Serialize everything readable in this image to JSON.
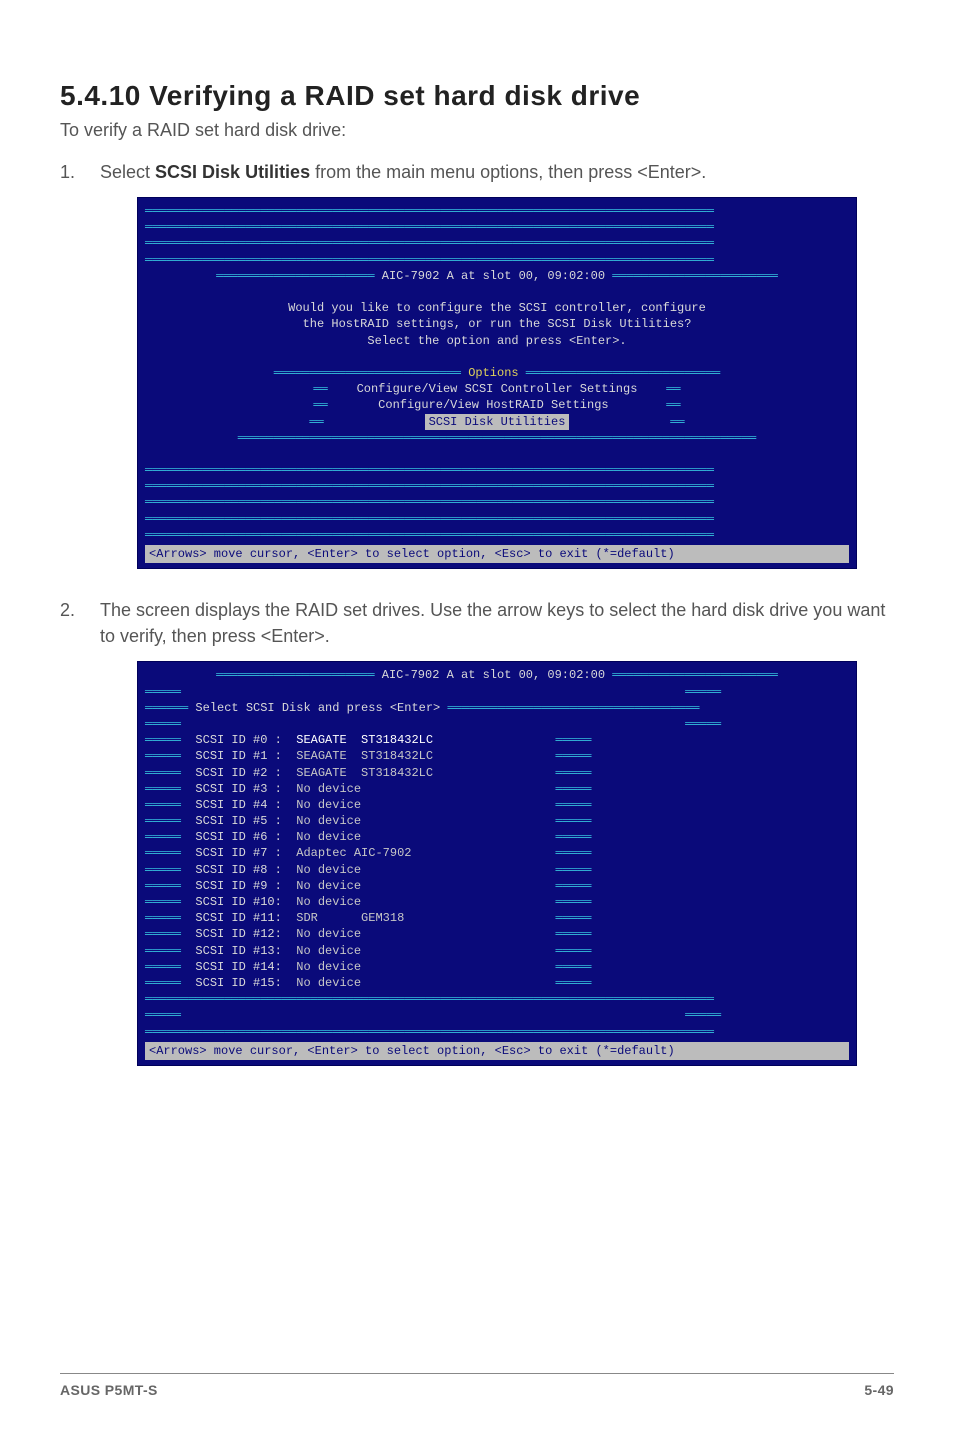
{
  "section_heading": "5.4.10 Verifying a RAID set hard disk drive",
  "intro_text": "To verify a RAID set hard disk drive:",
  "steps": [
    {
      "pre_bold": "Select ",
      "bold": "SCSI Disk Utilities",
      "post_bold": " from the main menu options, then press <Enter>."
    },
    {
      "text": "The screen displays the RAID set drives. Use the arrow keys to select the hard disk drive you want to verify, then press <Enter>."
    }
  ],
  "bios1": {
    "title_line": "AIC-7902 A at slot 00, 09:02:00",
    "prompt_lines": [
      "Would you like to configure the SCSI controller, configure",
      "the HostRAID settings, or run the SCSI Disk Utilities?",
      "Select the option and press <Enter>."
    ],
    "options_header": "Options",
    "options": [
      "Configure/View SCSI Controller Settings",
      "Configure/View HostRAID Settings",
      "SCSI Disk Utilities"
    ],
    "selected_index": 2,
    "footer": "<Arrows> move cursor, <Enter> to select option, <Esc> to exit (*=default)"
  },
  "bios2": {
    "title_line": "AIC-7902 A at slot 00, 09:02:00",
    "subtitle": "Select SCSI Disk and press <Enter>",
    "devices": [
      {
        "id": "SCSI ID #0 :",
        "desc": "SEAGATE  ST318432LC"
      },
      {
        "id": "SCSI ID #1 :",
        "desc": "SEAGATE  ST318432LC"
      },
      {
        "id": "SCSI ID #2 :",
        "desc": "SEAGATE  ST318432LC"
      },
      {
        "id": "SCSI ID #3 :",
        "desc": "No device"
      },
      {
        "id": "SCSI ID #4 :",
        "desc": "No device"
      },
      {
        "id": "SCSI ID #5 :",
        "desc": "No device"
      },
      {
        "id": "SCSI ID #6 :",
        "desc": "No device"
      },
      {
        "id": "SCSI ID #7 :",
        "desc": "Adaptec AIC-7902"
      },
      {
        "id": "SCSI ID #8 :",
        "desc": "No device"
      },
      {
        "id": "SCSI ID #9 :",
        "desc": "No device"
      },
      {
        "id": "SCSI ID #10:",
        "desc": "No device"
      },
      {
        "id": "SCSI ID #11:",
        "desc": "SDR      GEM318"
      },
      {
        "id": "SCSI ID #12:",
        "desc": "No device"
      },
      {
        "id": "SCSI ID #13:",
        "desc": "No device"
      },
      {
        "id": "SCSI ID #14:",
        "desc": "No device"
      },
      {
        "id": "SCSI ID #15:",
        "desc": "No device"
      }
    ],
    "selected_index": 0,
    "footer": "<Arrows> move cursor, <Enter> to select option, <Esc> to exit (*=default)"
  },
  "page_footer_left": "ASUS P5MT-S",
  "page_footer_right": "5-49"
}
